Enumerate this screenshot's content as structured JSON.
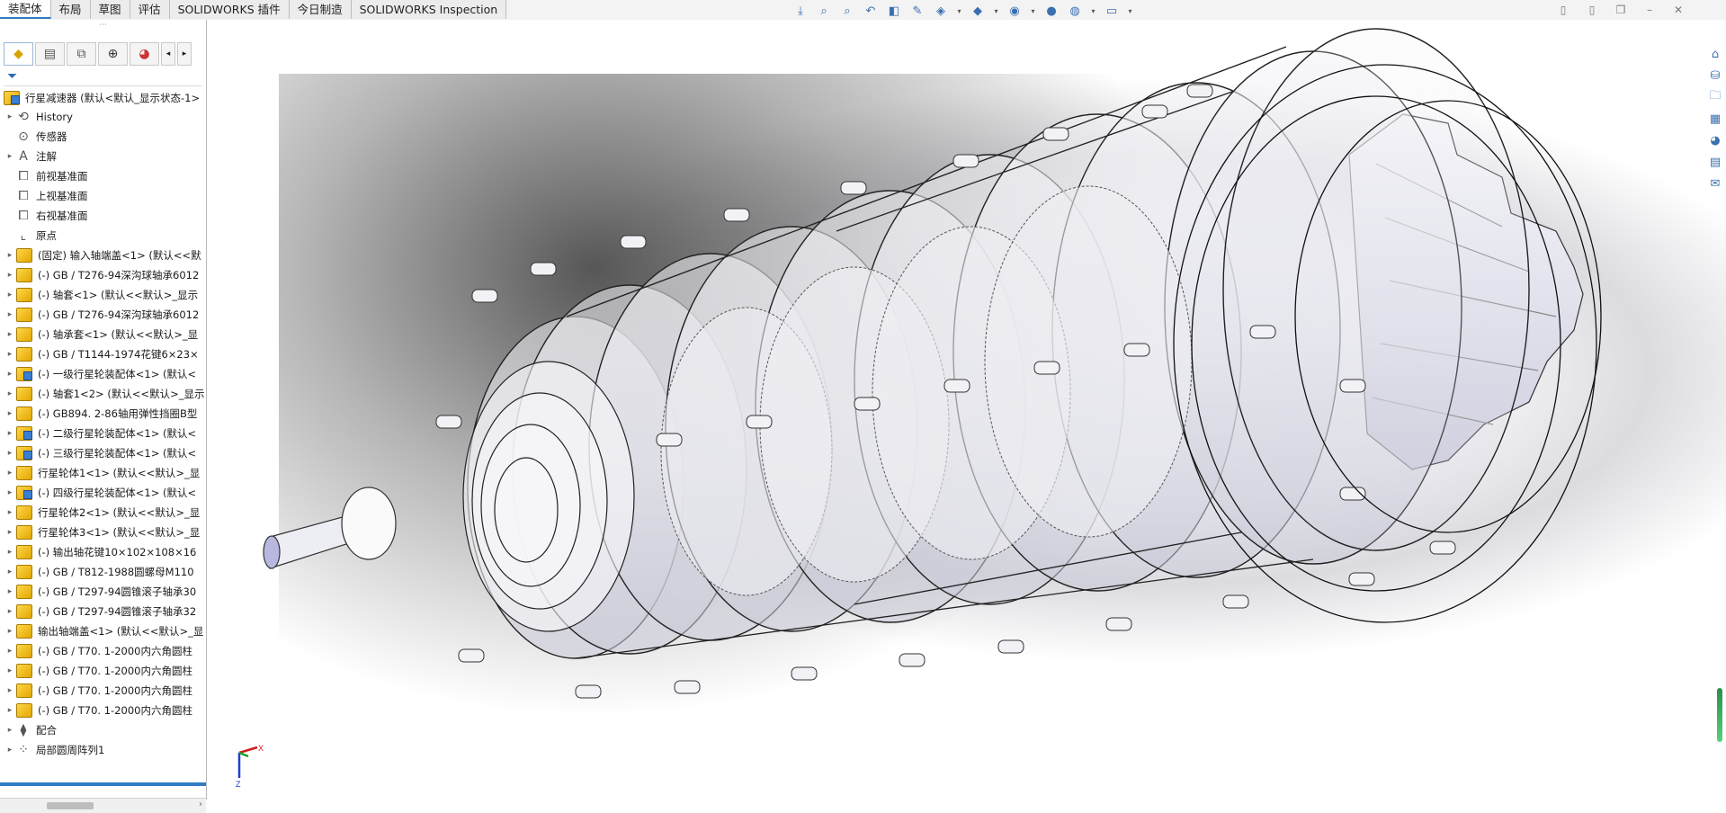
{
  "tabs": [
    {
      "label": "装配体",
      "active": true
    },
    {
      "label": "布局",
      "active": false
    },
    {
      "label": "草图",
      "active": false
    },
    {
      "label": "评估",
      "active": false
    },
    {
      "label": "SOLIDWORKS 插件",
      "active": false
    },
    {
      "label": "今日制造",
      "active": false
    },
    {
      "label": "SOLIDWORKS Inspection",
      "active": false
    }
  ],
  "feature_tree": {
    "root": "行星减速器 (默认<默认_显示状态-1>",
    "items": [
      {
        "label": "History",
        "icon": "history-icon",
        "expandable": true
      },
      {
        "label": "传感器",
        "icon": "sensor-icon",
        "expandable": false
      },
      {
        "label": "注解",
        "icon": "annotation-icon",
        "expandable": true
      },
      {
        "label": "前视基准面",
        "icon": "plane-icon",
        "expandable": false
      },
      {
        "label": "上视基准面",
        "icon": "plane-icon",
        "expandable": false
      },
      {
        "label": "右视基准面",
        "icon": "plane-icon",
        "expandable": false
      },
      {
        "label": "原点",
        "icon": "origin-icon",
        "expandable": false
      },
      {
        "label": "(固定) 输入轴端盖<1> (默认<<默",
        "icon": "part-icon",
        "expandable": true
      },
      {
        "label": "(-) GB / T276-94深沟球轴承6012",
        "icon": "part-icon",
        "expandable": true
      },
      {
        "label": "(-) 轴套<1> (默认<<默认>_显示",
        "icon": "part-icon",
        "expandable": true
      },
      {
        "label": "(-) GB / T276-94深沟球轴承6012",
        "icon": "part-icon",
        "expandable": true
      },
      {
        "label": "(-) 轴承套<1> (默认<<默认>_显",
        "icon": "part-icon",
        "expandable": true
      },
      {
        "label": "(-) GB / T1144-1974花键6×23×",
        "icon": "part-icon",
        "expandable": true
      },
      {
        "label": "(-) 一级行星轮装配体<1> (默认<",
        "icon": "assembly-icon",
        "expandable": true
      },
      {
        "label": "(-) 轴套1<2> (默认<<默认>_显示",
        "icon": "part-icon",
        "expandable": true
      },
      {
        "label": "(-) GB894. 2-86轴用弹性挡圈B型",
        "icon": "part-icon",
        "expandable": true
      },
      {
        "label": "(-) 二级行星轮装配体<1> (默认<",
        "icon": "assembly-icon",
        "expandable": true
      },
      {
        "label": "(-) 三级行星轮装配体<1> (默认<",
        "icon": "assembly-icon",
        "expandable": true
      },
      {
        "label": "行星轮体1<1> (默认<<默认>_显",
        "icon": "part-icon",
        "expandable": true
      },
      {
        "label": "(-) 四级行星轮装配体<1> (默认<",
        "icon": "assembly-icon",
        "expandable": true
      },
      {
        "label": "行星轮体2<1> (默认<<默认>_显",
        "icon": "part-icon",
        "expandable": true
      },
      {
        "label": "行星轮体3<1> (默认<<默认>_显",
        "icon": "part-icon",
        "expandable": true
      },
      {
        "label": "(-) 输出轴花键10×102×108×16",
        "icon": "part-icon",
        "expandable": true
      },
      {
        "label": "(-) GB / T812-1988圆螺母M110",
        "icon": "part-icon",
        "expandable": true
      },
      {
        "label": "(-) GB / T297-94圆锥滚子轴承30",
        "icon": "part-icon",
        "expandable": true
      },
      {
        "label": "(-) GB / T297-94圆锥滚子轴承32",
        "icon": "part-icon",
        "expandable": true
      },
      {
        "label": "输出轴端盖<1> (默认<<默认>_显",
        "icon": "part-icon",
        "expandable": true
      },
      {
        "label": "(-) GB / T70. 1-2000内六角圆柱",
        "icon": "part-icon",
        "expandable": true
      },
      {
        "label": "(-) GB / T70. 1-2000内六角圆柱",
        "icon": "part-icon",
        "expandable": true
      },
      {
        "label": "(-) GB / T70. 1-2000内六角圆柱",
        "icon": "part-icon",
        "expandable": true
      },
      {
        "label": "(-) GB / T70. 1-2000内六角圆柱",
        "icon": "part-icon",
        "expandable": true
      },
      {
        "label": "配合",
        "icon": "mates-icon",
        "expandable": true
      },
      {
        "label": "局部圆周阵列1",
        "icon": "pattern-icon",
        "expandable": true
      }
    ]
  },
  "triad": {
    "x_label": "X",
    "z_label": "Z"
  },
  "colors": {
    "accent": "#2f7cc4",
    "part_yellow": "#f2c12e"
  }
}
